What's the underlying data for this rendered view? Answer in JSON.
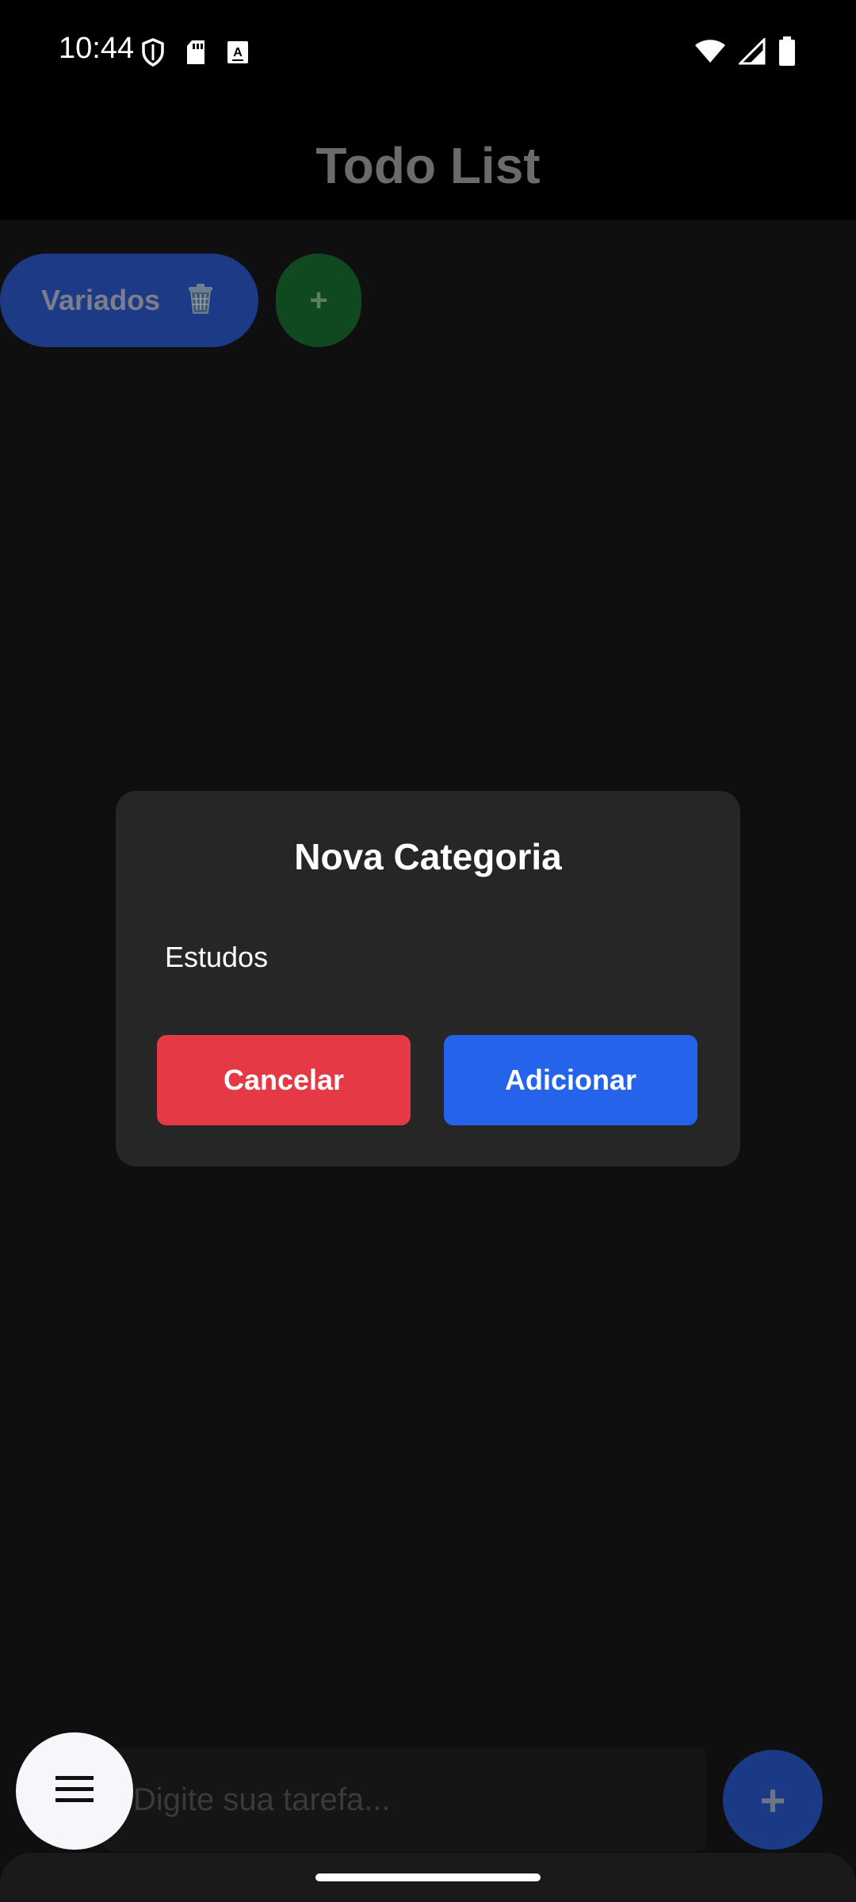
{
  "status_bar": {
    "time": "10:44",
    "left_icons": [
      "shield-icon",
      "sd-card-icon",
      "keyboard-a-icon"
    ],
    "right_icons": [
      "wifi-icon",
      "signal-icon",
      "battery-icon"
    ]
  },
  "app_bar": {
    "title": "Todo List"
  },
  "categories": {
    "items": [
      {
        "label": "Variados",
        "icon": "trash-icon"
      }
    ],
    "add_label": "+",
    "colors": {
      "chip": "#1c3a86",
      "add": "#10481f"
    }
  },
  "dialog": {
    "title": "Nova Categoria",
    "input_value": "Estudos",
    "cancel_label": "Cancelar",
    "confirm_label": "Adicionar",
    "colors": {
      "cancel": "#e63946",
      "confirm": "#2563eb"
    }
  },
  "bottom": {
    "input_placeholder": "Digite sua tarefa...",
    "add_label": "+",
    "menu_icon": "menu-icon"
  }
}
